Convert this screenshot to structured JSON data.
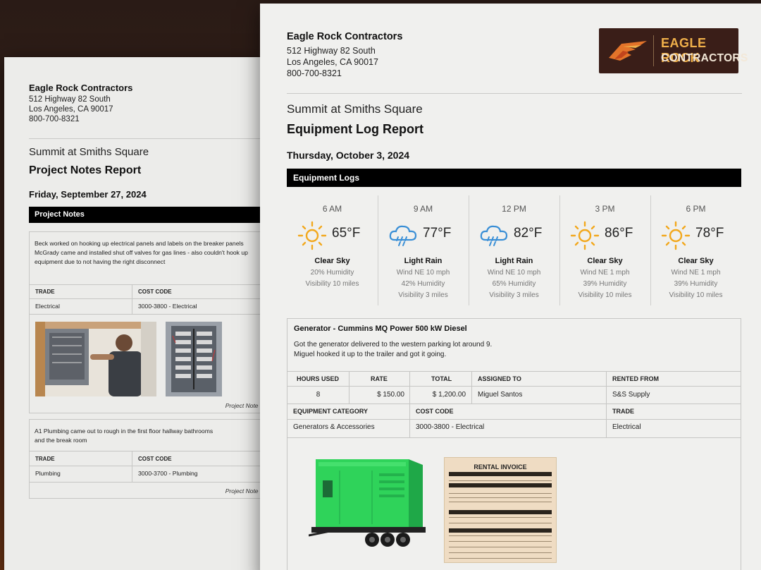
{
  "back_sheet": {
    "company": "Eagle Rock Contractors",
    "address_line1": "512 Highway 82 South",
    "address_line2": "Los Angeles, CA 90017",
    "phone": "800-700-8321",
    "project": "Summit at Smiths Square",
    "title": "Project Notes Report",
    "date": "Friday, September 27, 2024",
    "section": "Project Notes",
    "notes": [
      {
        "lines": [
          "Beck worked on hooking up electrical panels and labels on the breaker panels",
          "McGrady came and installed shut off valves for gas lines - also couldn't hook up",
          "equipment due to not having the right disconnect"
        ],
        "trade_header": "TRADE",
        "cost_header": "COST CODE",
        "trade": "Electrical",
        "cost_code": "3000-3800 - Electrical",
        "caption": "Project Note fo"
      },
      {
        "lines": [
          "A1 Plumbing came out to rough in the first floor hallway bathrooms",
          "and the break room"
        ],
        "trade_header": "TRADE",
        "cost_header": "COST CODE",
        "trade": "Plumbing",
        "cost_code": "3000-3700 - Plumbing",
        "caption": "Project Note fo"
      }
    ]
  },
  "front_sheet": {
    "company": "Eagle Rock Contractors",
    "address_line1": "512 Highway 82 South",
    "address_line2": "Los Angeles, CA 90017",
    "phone": "800-700-8321",
    "logo": {
      "line1": "EAGLE ROCK",
      "line2": "CONTRACTORS",
      "accent": "#f0b04a",
      "bg": "#3a1e18"
    },
    "project": "Summit at Smiths Square",
    "title": "Equipment Log Report",
    "date": "Thursday, October 3, 2024",
    "section": "Equipment Logs",
    "weather": [
      {
        "time": "6 AM",
        "icon": "sun-icon",
        "temp": "65°F",
        "condition": "Clear Sky",
        "l1": "20% Humidity",
        "l2": "Visibility 10 miles",
        "l3": ""
      },
      {
        "time": "9 AM",
        "icon": "rain-cloud-icon",
        "temp": "77°F",
        "condition": "Light Rain",
        "l1": "Wind NE 10 mph",
        "l2": "42% Humidity",
        "l3": "Visibility 3 miles"
      },
      {
        "time": "12 PM",
        "icon": "rain-cloud-icon",
        "temp": "82°F",
        "condition": "Light Rain",
        "l1": "Wind NE 10 mph",
        "l2": "65% Humidity",
        "l3": "Visibility 3 miles"
      },
      {
        "time": "3 PM",
        "icon": "sun-icon",
        "temp": "86°F",
        "condition": "Clear Sky",
        "l1": "Wind NE 1 mph",
        "l2": "39% Humidity",
        "l3": "Visibility 10 miles"
      },
      {
        "time": "6 PM",
        "icon": "sun-icon",
        "temp": "78°F",
        "condition": "Clear Sky",
        "l1": "Wind NE 1 mph",
        "l2": "39% Humidity",
        "l3": "Visibility 10 miles"
      }
    ],
    "equipment": {
      "name": "Generator - Cummins MQ Power 500 kW Diesel",
      "desc_line1": "Got the generator delivered to the western parking lot around 9.",
      "desc_line2": "Miguel hooked it up to the trailer and got it going.",
      "headers": {
        "hours": "HOURS USED",
        "rate": "RATE",
        "total": "TOTAL",
        "assigned": "ASSIGNED TO",
        "rented": "RENTED FROM",
        "category": "EQUIPMENT CATEGORY",
        "cost_code": "COST CODE",
        "trade": "TRADE"
      },
      "values": {
        "hours": "8",
        "rate": "$ 150.00",
        "total": "$ 1,200.00",
        "assigned": "Miguel Santos",
        "rented": "S&S Supply",
        "category": "Generators & Accessories",
        "cost_code": "3000-3800 - Electrical",
        "trade": "Electrical"
      },
      "invoice_title": "RENTAL INVOICE",
      "generator_color": "#2fd35a"
    }
  }
}
